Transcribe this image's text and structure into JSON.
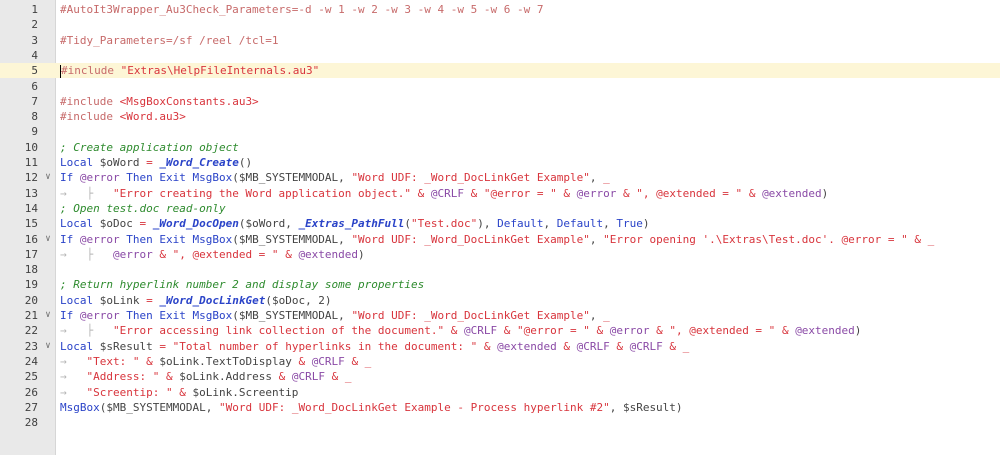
{
  "editor": {
    "active_line": 5,
    "lines": [
      {
        "n": "1",
        "fold": "",
        "segs": [
          [
            "dir",
            "#AutoIt3Wrapper_Au3Check_Parameters=-d -w 1 -w 2 -w 3 -w 4 -w 5 -w 6 -w 7"
          ]
        ]
      },
      {
        "n": "2",
        "fold": "",
        "segs": []
      },
      {
        "n": "3",
        "fold": "",
        "segs": [
          [
            "dir",
            "#Tidy_Parameters=/sf /reel /tcl=1"
          ]
        ]
      },
      {
        "n": "4",
        "fold": "",
        "segs": []
      },
      {
        "n": "5",
        "fold": "",
        "segs": [
          [
            "caret",
            ""
          ],
          [
            "dir",
            "#include "
          ],
          [
            "str",
            "\"Extras\\HelpFileInternals.au3\""
          ]
        ]
      },
      {
        "n": "6",
        "fold": "",
        "segs": []
      },
      {
        "n": "7",
        "fold": "",
        "segs": [
          [
            "dir",
            "#include "
          ],
          [
            "str",
            "<MsgBoxConstants.au3>"
          ]
        ]
      },
      {
        "n": "8",
        "fold": "",
        "segs": [
          [
            "dir",
            "#include "
          ],
          [
            "str",
            "<Word.au3>"
          ]
        ]
      },
      {
        "n": "9",
        "fold": "",
        "segs": []
      },
      {
        "n": "10",
        "fold": "",
        "segs": [
          [
            "cmt",
            "; Create application object"
          ]
        ]
      },
      {
        "n": "11",
        "fold": "",
        "segs": [
          [
            "kw",
            "Local "
          ],
          [
            "var",
            "$oWord "
          ],
          [
            "op",
            "= "
          ],
          [
            "udf",
            "_Word_Create"
          ],
          [
            "id",
            "()"
          ]
        ]
      },
      {
        "n": "12",
        "fold": "∨",
        "segs": [
          [
            "kw",
            "If "
          ],
          [
            "mac",
            "@error "
          ],
          [
            "kw",
            "Then Exit "
          ],
          [
            "fn",
            "MsgBox"
          ],
          [
            "id",
            "($MB_SYSTEMMODAL, "
          ],
          [
            "str",
            "\"Word UDF: _Word_DocLinkGet Example\""
          ],
          [
            "id",
            ", "
          ],
          [
            "op",
            "_"
          ]
        ]
      },
      {
        "n": "13",
        "fold": "",
        "segs": [
          [
            "ws",
            "→   ├   "
          ],
          [
            "str",
            "\"Error creating the Word application object.\" "
          ],
          [
            "op",
            "& "
          ],
          [
            "mac",
            "@CRLF "
          ],
          [
            "op",
            "& "
          ],
          [
            "str",
            "\"@error = \" "
          ],
          [
            "op",
            "& "
          ],
          [
            "mac",
            "@error "
          ],
          [
            "op",
            "& "
          ],
          [
            "str",
            "\", @extended = \" "
          ],
          [
            "op",
            "& "
          ],
          [
            "mac",
            "@extended"
          ],
          [
            "id",
            ")"
          ]
        ]
      },
      {
        "n": "14",
        "fold": "",
        "segs": [
          [
            "cmt",
            "; Open test.doc read-only"
          ]
        ]
      },
      {
        "n": "15",
        "fold": "",
        "segs": [
          [
            "kw",
            "Local "
          ],
          [
            "var",
            "$oDoc "
          ],
          [
            "op",
            "= "
          ],
          [
            "udf",
            "_Word_DocOpen"
          ],
          [
            "id",
            "($oWord, "
          ],
          [
            "udf",
            "_Extras_PathFull"
          ],
          [
            "id",
            "("
          ],
          [
            "str",
            "\"Test.doc\""
          ],
          [
            "id",
            "), "
          ],
          [
            "kw",
            "Default"
          ],
          [
            "id",
            ", "
          ],
          [
            "kw",
            "Default"
          ],
          [
            "id",
            ", "
          ],
          [
            "kw",
            "True"
          ],
          [
            "id",
            ")"
          ]
        ]
      },
      {
        "n": "16",
        "fold": "∨",
        "segs": [
          [
            "kw",
            "If "
          ],
          [
            "mac",
            "@error "
          ],
          [
            "kw",
            "Then Exit "
          ],
          [
            "fn",
            "MsgBox"
          ],
          [
            "id",
            "($MB_SYSTEMMODAL, "
          ],
          [
            "str",
            "\"Word UDF: _Word_DocLinkGet Example\""
          ],
          [
            "id",
            ", "
          ],
          [
            "str",
            "\"Error opening '.\\Extras\\Test.doc'. @error = \" "
          ],
          [
            "op",
            "& _"
          ]
        ]
      },
      {
        "n": "17",
        "fold": "",
        "segs": [
          [
            "ws",
            "→   ├   "
          ],
          [
            "mac",
            "@error "
          ],
          [
            "op",
            "& "
          ],
          [
            "str",
            "\", @extended = \" "
          ],
          [
            "op",
            "& "
          ],
          [
            "mac",
            "@extended"
          ],
          [
            "id",
            ")"
          ]
        ]
      },
      {
        "n": "18",
        "fold": "",
        "segs": []
      },
      {
        "n": "19",
        "fold": "",
        "segs": [
          [
            "cmt",
            "; Return hyperlink number 2 and display some properties"
          ]
        ]
      },
      {
        "n": "20",
        "fold": "",
        "segs": [
          [
            "kw",
            "Local "
          ],
          [
            "var",
            "$oLink "
          ],
          [
            "op",
            "= "
          ],
          [
            "udf",
            "_Word_DocLinkGet"
          ],
          [
            "id",
            "($oDoc, 2)"
          ]
        ]
      },
      {
        "n": "21",
        "fold": "∨",
        "segs": [
          [
            "kw",
            "If "
          ],
          [
            "mac",
            "@error "
          ],
          [
            "kw",
            "Then Exit "
          ],
          [
            "fn",
            "MsgBox"
          ],
          [
            "id",
            "($MB_SYSTEMMODAL, "
          ],
          [
            "str",
            "\"Word UDF: _Word_DocLinkGet Example\""
          ],
          [
            "id",
            ", "
          ],
          [
            "op",
            "_"
          ]
        ]
      },
      {
        "n": "22",
        "fold": "",
        "segs": [
          [
            "ws",
            "→   ├   "
          ],
          [
            "str",
            "\"Error accessing link collection of the document.\" "
          ],
          [
            "op",
            "& "
          ],
          [
            "mac",
            "@CRLF "
          ],
          [
            "op",
            "& "
          ],
          [
            "str",
            "\"@error = \" "
          ],
          [
            "op",
            "& "
          ],
          [
            "mac",
            "@error "
          ],
          [
            "op",
            "& "
          ],
          [
            "str",
            "\", @extended = \" "
          ],
          [
            "op",
            "& "
          ],
          [
            "mac",
            "@extended"
          ],
          [
            "id",
            ")"
          ]
        ]
      },
      {
        "n": "23",
        "fold": "∨",
        "segs": [
          [
            "kw",
            "Local "
          ],
          [
            "var",
            "$sResult "
          ],
          [
            "op",
            "= "
          ],
          [
            "str",
            "\"Total number of hyperlinks in the document: \" "
          ],
          [
            "op",
            "& "
          ],
          [
            "mac",
            "@extended "
          ],
          [
            "op",
            "& "
          ],
          [
            "mac",
            "@CRLF "
          ],
          [
            "op",
            "& "
          ],
          [
            "mac",
            "@CRLF "
          ],
          [
            "op",
            "& _"
          ]
        ]
      },
      {
        "n": "24",
        "fold": "",
        "segs": [
          [
            "ws",
            "→   "
          ],
          [
            "str",
            "\"Text: \" "
          ],
          [
            "op",
            "& "
          ],
          [
            "var",
            "$oLink.TextToDisplay "
          ],
          [
            "op",
            "& "
          ],
          [
            "mac",
            "@CRLF "
          ],
          [
            "op",
            "& _"
          ]
        ]
      },
      {
        "n": "25",
        "fold": "",
        "segs": [
          [
            "ws",
            "→   "
          ],
          [
            "str",
            "\"Address: \" "
          ],
          [
            "op",
            "& "
          ],
          [
            "var",
            "$oLink.Address "
          ],
          [
            "op",
            "& "
          ],
          [
            "mac",
            "@CRLF "
          ],
          [
            "op",
            "& _"
          ]
        ]
      },
      {
        "n": "26",
        "fold": "",
        "segs": [
          [
            "ws",
            "→   "
          ],
          [
            "str",
            "\"Screentip: \" "
          ],
          [
            "op",
            "& "
          ],
          [
            "var",
            "$oLink.Screentip"
          ]
        ]
      },
      {
        "n": "27",
        "fold": "",
        "segs": [
          [
            "fn",
            "MsgBox"
          ],
          [
            "id",
            "($MB_SYSTEMMODAL, "
          ],
          [
            "str",
            "\"Word UDF: _Word_DocLinkGet Example - Process hyperlink #2\""
          ],
          [
            "id",
            ", $sResult)"
          ]
        ]
      },
      {
        "n": "28",
        "fold": "",
        "segs": []
      }
    ]
  }
}
